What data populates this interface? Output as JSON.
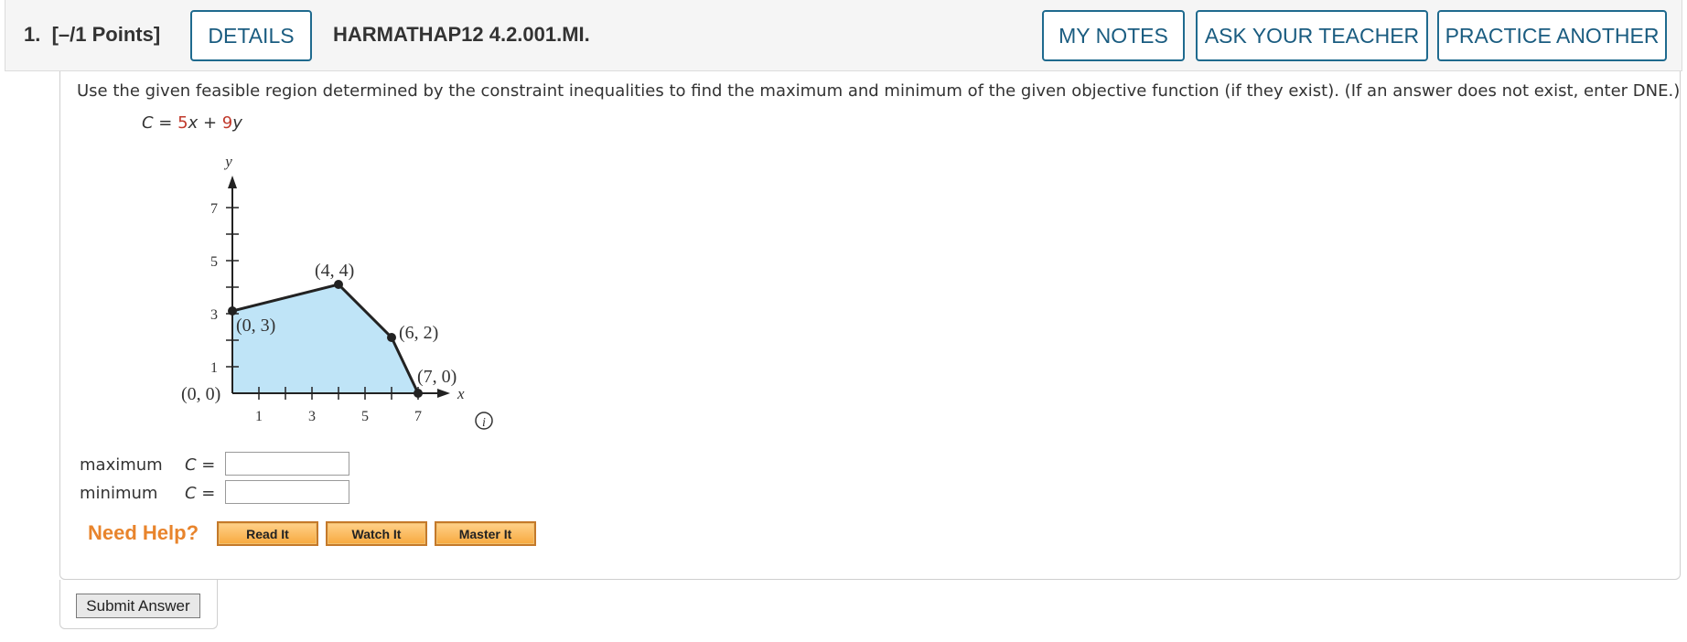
{
  "header": {
    "question_number": "1.",
    "points": "[–/1 Points]",
    "details_label": "DETAILS",
    "problem_code": "HARMATHAP12 4.2.001.MI.",
    "my_notes_label": "MY NOTES",
    "ask_teacher_label": "ASK YOUR TEACHER",
    "practice_label": "PRACTICE ANOTHER"
  },
  "question": {
    "text": "Use the given feasible region determined by the constraint inequalities to find the maximum and minimum of the given objective function (if they exist). (If an answer does not exist, enter DNE.)",
    "objective": {
      "lhs": "C",
      "eq": " = ",
      "coef_x": "5",
      "var_x": "x",
      "plus": " + ",
      "coef_y": "9",
      "var_y": "y"
    }
  },
  "graph": {
    "y_axis_label": "y",
    "x_axis_label": "x",
    "y_ticks": [
      "7",
      "5",
      "3",
      "1"
    ],
    "x_ticks": [
      "1",
      "3",
      "5",
      "7"
    ],
    "vertices": [
      "(0, 0)",
      "(0, 3)",
      "(4, 4)",
      "(6, 2)",
      "(7, 0)"
    ],
    "fill_color": "#bfe4f7"
  },
  "answers": {
    "maximum_label": "maximum",
    "minimum_label": "minimum",
    "c_eq": "C =",
    "maximum_value": "",
    "minimum_value": ""
  },
  "help": {
    "need_help": "Need Help?",
    "read_it": "Read It",
    "watch_it": "Watch It",
    "master_it": "Master It"
  },
  "submit_label": "Submit Answer"
}
